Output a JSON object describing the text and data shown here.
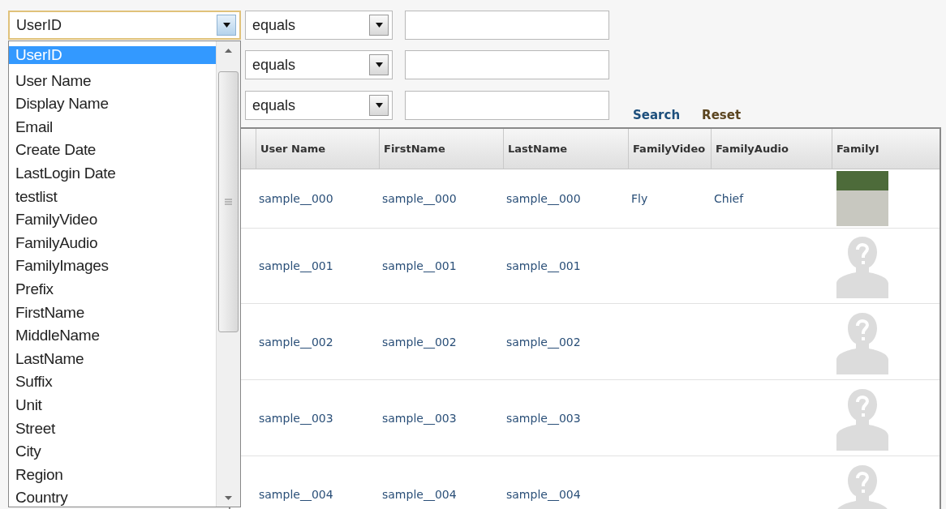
{
  "filters": [
    {
      "field": "UserID",
      "operator": "equals"
    },
    {
      "operator": "equals"
    },
    {
      "operator": "equals"
    }
  ],
  "field_dropdown": {
    "expanded": true,
    "options": [
      {
        "label": "UserID",
        "selected": true
      },
      {
        "label": "User Name",
        "selected": false
      },
      {
        "label": "Display Name",
        "selected": false
      },
      {
        "label": "Email",
        "selected": false
      },
      {
        "label": "Create Date",
        "selected": false
      },
      {
        "label": "LastLogin Date",
        "selected": false
      },
      {
        "label": "testlist",
        "selected": false
      },
      {
        "label": "FamilyVideo",
        "selected": false
      },
      {
        "label": "FamilyAudio",
        "selected": false
      },
      {
        "label": "FamilyImages",
        "selected": false
      },
      {
        "label": "Prefix",
        "selected": false
      },
      {
        "label": "FirstName",
        "selected": false
      },
      {
        "label": "MiddleName",
        "selected": false
      },
      {
        "label": "LastName",
        "selected": false
      },
      {
        "label": "Suffix",
        "selected": false
      },
      {
        "label": "Unit",
        "selected": false
      },
      {
        "label": "Street",
        "selected": false
      },
      {
        "label": "City",
        "selected": false
      },
      {
        "label": "Region",
        "selected": false
      },
      {
        "label": "Country",
        "selected": false
      }
    ]
  },
  "actions": [
    "Search",
    "Reset"
  ],
  "table": {
    "columns": [
      "User Name",
      "FirstName",
      "LastName",
      "FamilyVideo",
      "FamilyAudio",
      "FamilyI"
    ],
    "rows": [
      {
        "cells": [
          "sample__000",
          "sample__000",
          "sample__000",
          "Fly",
          "Chief"
        ],
        "kind": "photo"
      },
      {
        "cells": [
          "sample__001",
          "sample__001",
          "sample__001"
        ],
        "kind": "placeholder"
      },
      {
        "cells": [
          "sample__002",
          "sample__002",
          "sample__002"
        ],
        "kind": "placeholder"
      },
      {
        "cells": [
          "sample__003",
          "sample__003",
          "sample__003"
        ],
        "kind": "placeholder"
      },
      {
        "cells": [
          "sample__004",
          "sample__004",
          "sample__004"
        ],
        "kind": "placeholder"
      }
    ]
  }
}
